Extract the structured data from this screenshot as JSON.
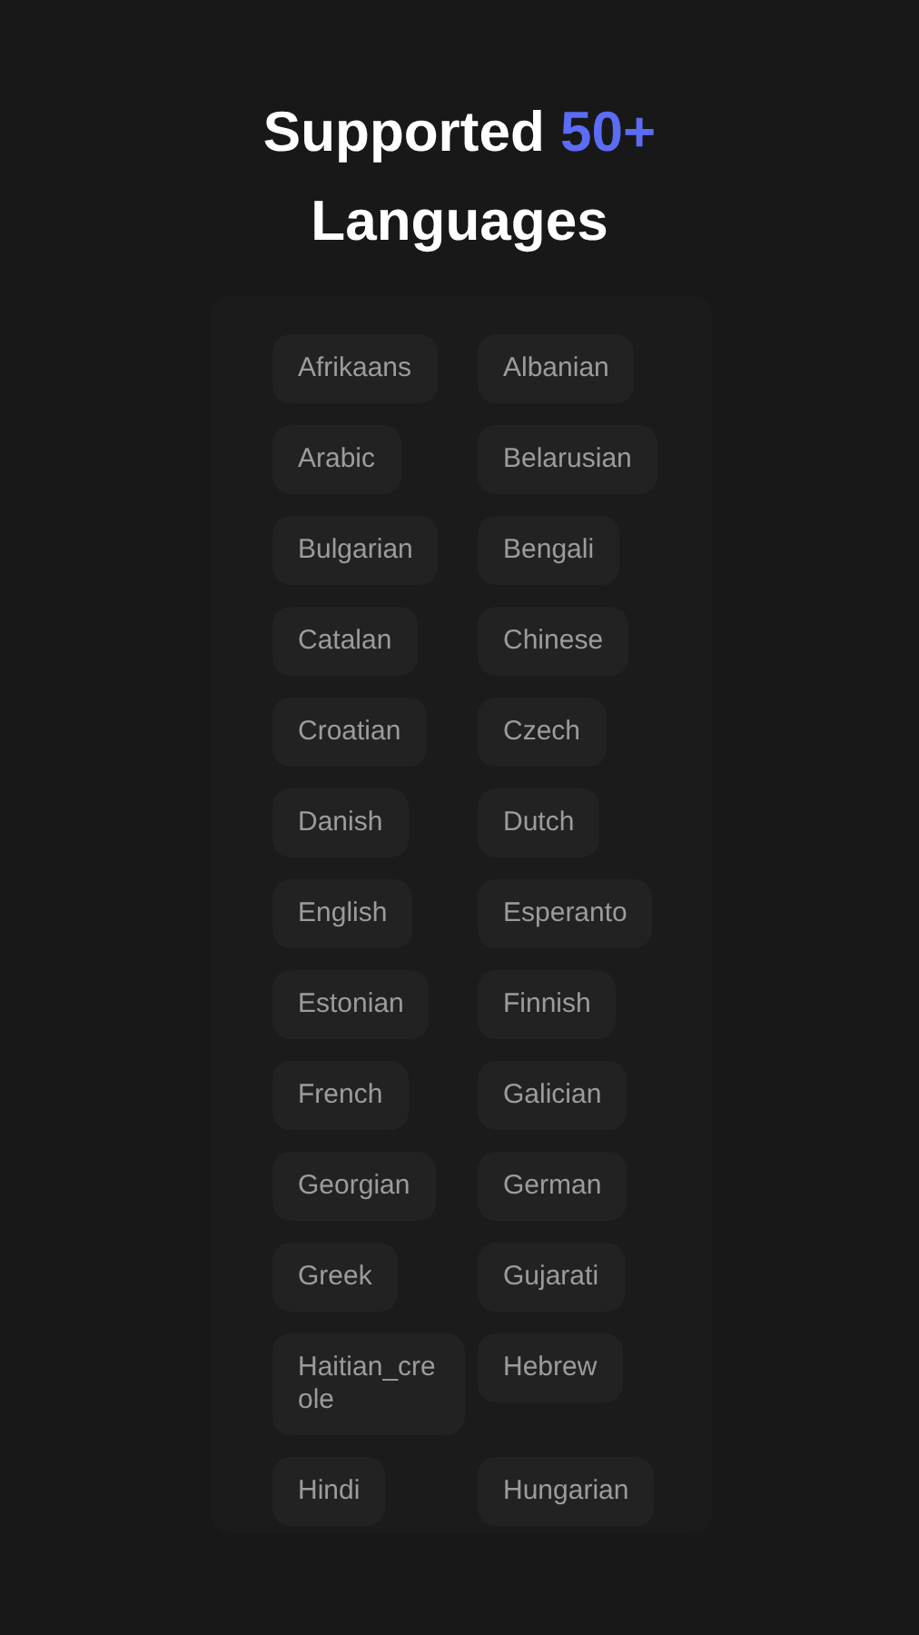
{
  "title": {
    "before": "Supported",
    "highlight": "50+",
    "after": "Languages"
  },
  "languages": [
    "Afrikaans",
    "Albanian",
    "Arabic",
    "Belarusian",
    "Bulgarian",
    "Bengali",
    "Catalan",
    "Chinese",
    "Croatian",
    "Czech",
    "Danish",
    "Dutch",
    "English",
    "Esperanto",
    "Estonian",
    "Finnish",
    "French",
    "Galician",
    "Georgian",
    "German",
    "Greek",
    "Gujarati",
    "Haitian_creole",
    "Hebrew",
    "Hindi",
    "Hungarian"
  ]
}
